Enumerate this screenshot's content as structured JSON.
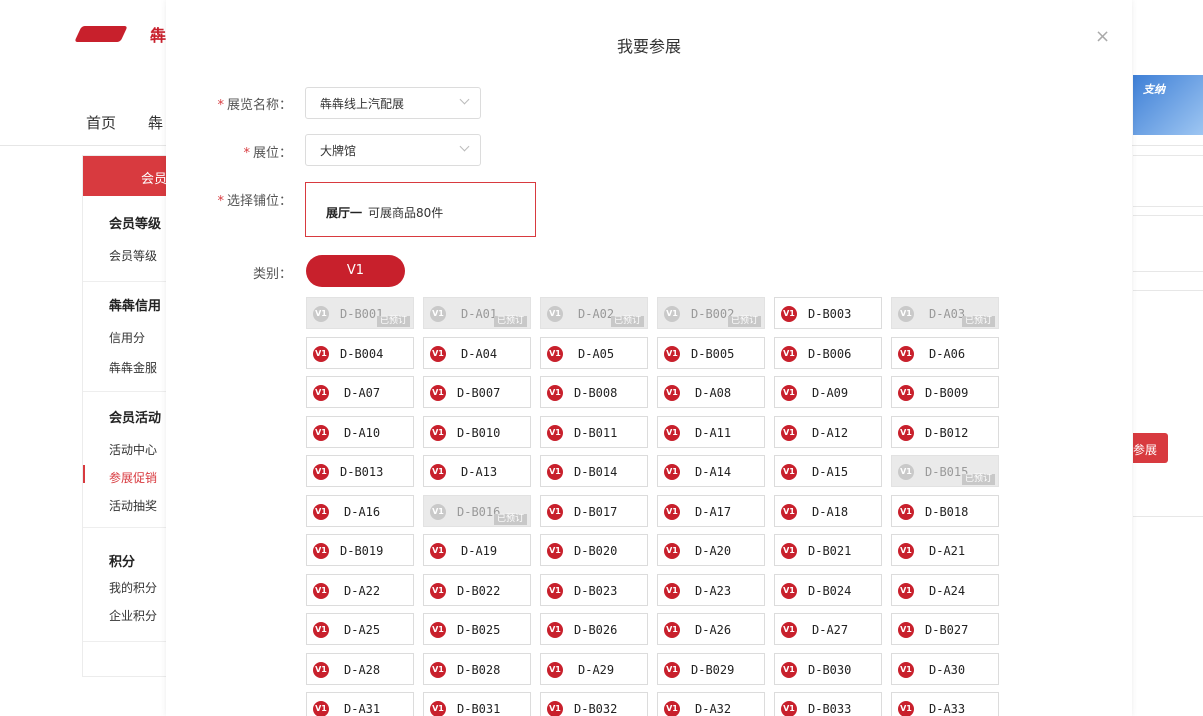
{
  "background": {
    "logo_text": "犇",
    "nav": [
      "首页",
      "犇"
    ],
    "sidebar": {
      "header": "会员",
      "groups": [
        {
          "title": "会员等级",
          "items": [
            "会员等级"
          ]
        },
        {
          "title": "犇犇信用",
          "items": [
            "信用分",
            "犇犇金服"
          ]
        },
        {
          "title": "会员活动",
          "items": [
            "活动中心",
            "参展促销",
            "活动抽奖"
          ]
        },
        {
          "title": "积分",
          "items": [
            "我的积分",
            "企业积分"
          ]
        }
      ],
      "active_item": "参展促销"
    },
    "right_banner_text": "支纳",
    "right_button": "参展"
  },
  "modal": {
    "title": "我要参展",
    "close_icon": "×",
    "fields": {
      "exhibition": {
        "label": "展览名称：",
        "value": "犇犇线上汽配展"
      },
      "booth_type": {
        "label": "展位：",
        "value": "大牌馆"
      },
      "stall": {
        "label": "选择铺位：",
        "hall": "展厅一",
        "capacity": "可展商品80件"
      },
      "category": {
        "label": "类别：",
        "value": "V1"
      }
    },
    "required_mark": "*",
    "badge_text": "V1",
    "booked_tag": "已预订",
    "booths": [
      [
        "D-B001",
        "D-A01",
        "D-A02",
        "D-B002",
        "D-B003",
        "D-A03"
      ],
      [
        "D-B004",
        "D-A04",
        "D-A05",
        "D-B005",
        "D-B006",
        "D-A06"
      ],
      [
        "D-A07",
        "D-B007",
        "D-B008",
        "D-A08",
        "D-A09",
        "D-B009"
      ],
      [
        "D-A10",
        "D-B010",
        "D-B011",
        "D-A11",
        "D-A12",
        "D-B012"
      ],
      [
        "D-B013",
        "D-A13",
        "D-B014",
        "D-A14",
        "D-A15",
        "D-B015"
      ],
      [
        "D-A16",
        "D-B016",
        "D-B017",
        "D-A17",
        "D-A18",
        "D-B018"
      ],
      [
        "D-B019",
        "D-A19",
        "D-B020",
        "D-A20",
        "D-B021",
        "D-A21"
      ],
      [
        "D-A22",
        "D-B022",
        "D-B023",
        "D-A23",
        "D-B024",
        "D-A24"
      ],
      [
        "D-A25",
        "D-B025",
        "D-B026",
        "D-A26",
        "D-A27",
        "D-B027"
      ],
      [
        "D-A28",
        "D-B028",
        "D-A29",
        "D-B029",
        "D-B030",
        "D-A30"
      ],
      [
        "D-A31",
        "D-B031",
        "D-B032",
        "D-A32",
        "D-B033",
        "D-A33"
      ]
    ],
    "booked": [
      "D-B001",
      "D-A01",
      "D-A02",
      "D-B002",
      "D-A03",
      "D-B015",
      "D-B016"
    ]
  }
}
